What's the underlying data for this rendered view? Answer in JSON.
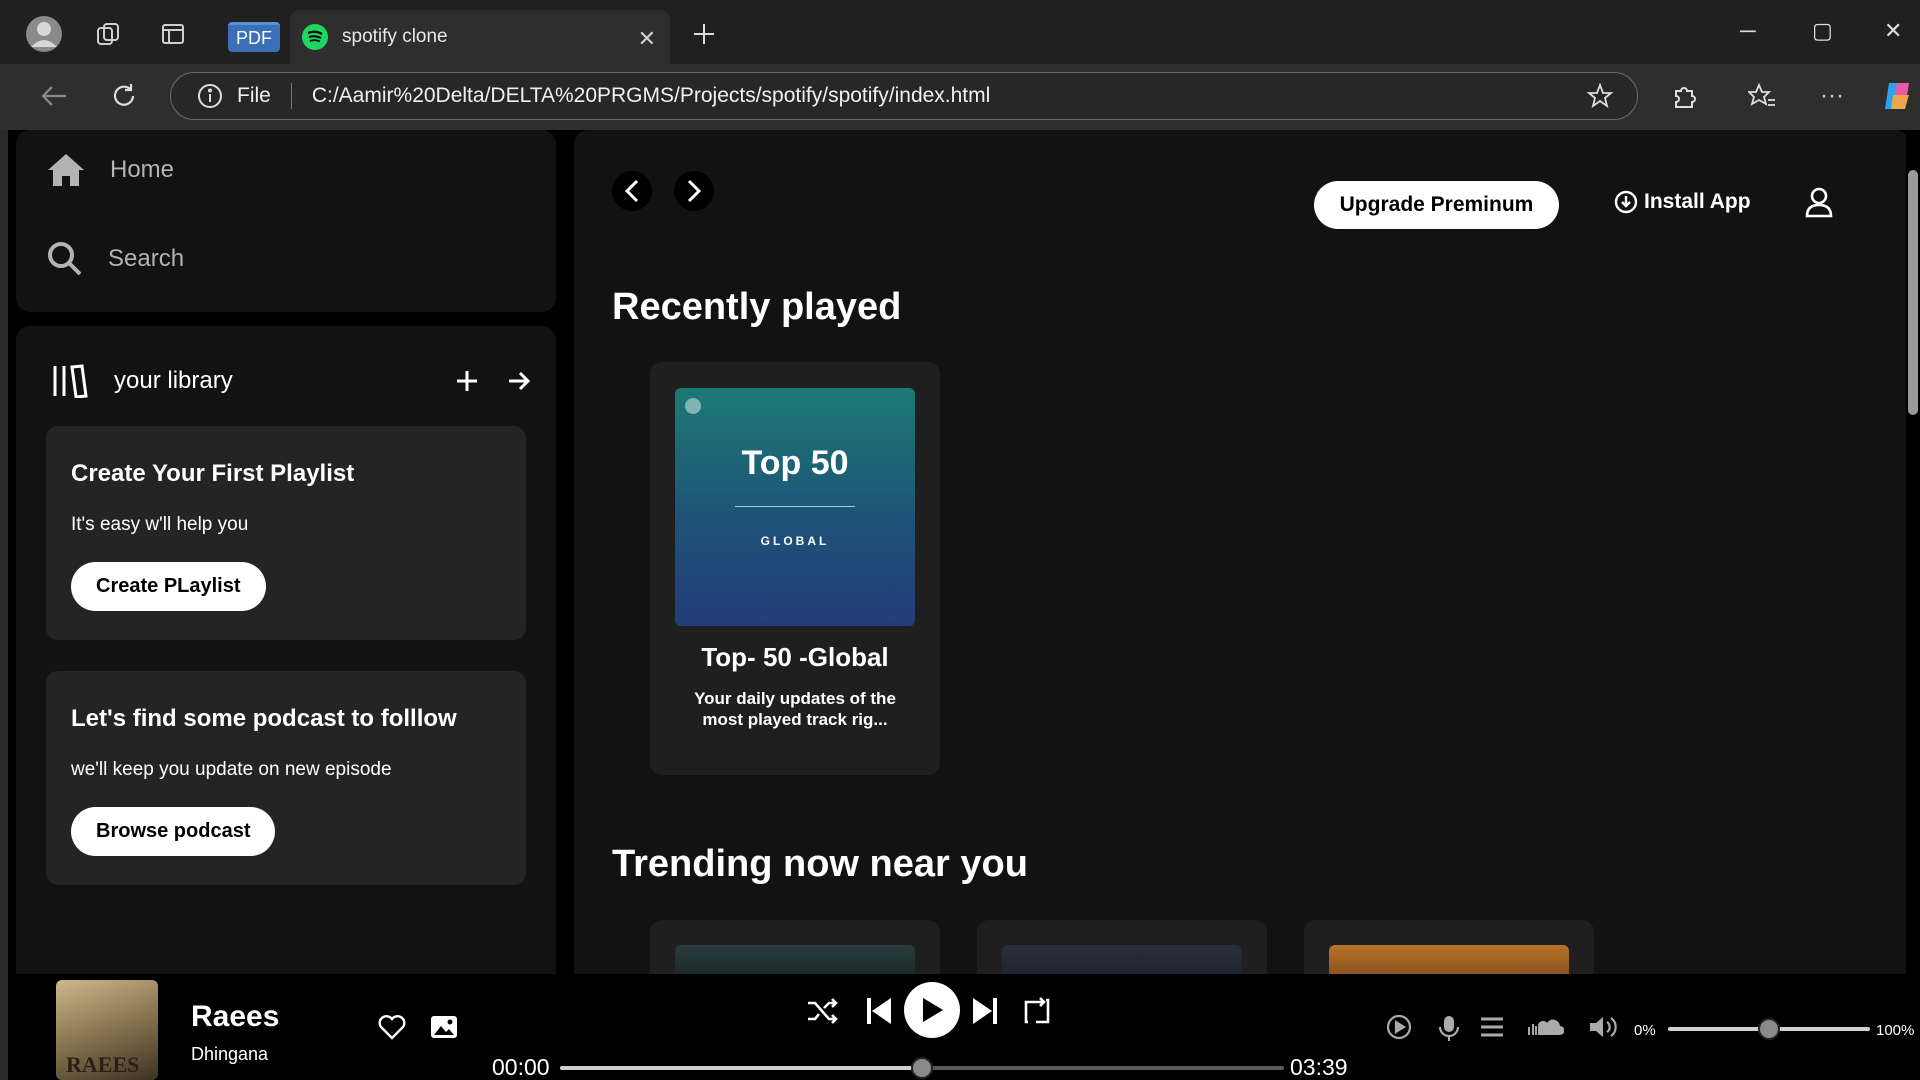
{
  "browser": {
    "pdf_badge": "PDF",
    "tab_title": "spotify clone",
    "url_scheme": "File",
    "url": "C:/Aamir%20Delta/DELTA%20PRGMS/Projects/spotify/spotify/index.html"
  },
  "nav": {
    "home": "Home",
    "search": "Search"
  },
  "library": {
    "title": "your library",
    "cards": [
      {
        "title": "Create Your First Playlist",
        "text": "It's easy w'll help you",
        "button": "Create PLaylist"
      },
      {
        "title": "Let's find some podcast to folllow",
        "text": "we'll keep you update on new episode",
        "button": "Browse podcast"
      }
    ]
  },
  "header": {
    "upgrade": "Upgrade Preminum",
    "install": "Install App"
  },
  "sections": {
    "recent": "Recently played",
    "trending": "Trending now near you"
  },
  "recent_card": {
    "cover_title": "Top 50",
    "cover_sub": "GLOBAL",
    "title": "Top- 50 -Global",
    "desc": "Your daily updates of the most played track rig..."
  },
  "player": {
    "song": "Raees",
    "artist": "Dhingana",
    "album_text": "RAEES",
    "current_time": "00:00",
    "total_time": "03:39",
    "progress": 0.5,
    "volume_min": "0%",
    "volume_max": "100%",
    "volume": 0.5
  }
}
